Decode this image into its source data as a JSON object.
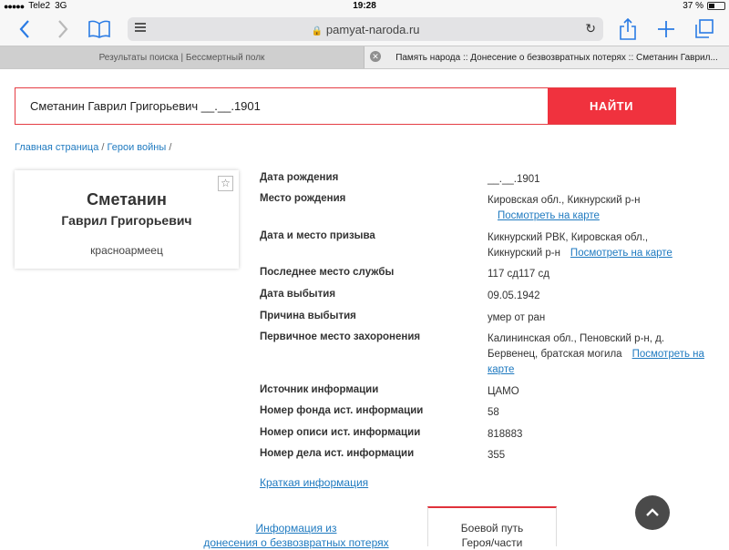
{
  "status_bar": {
    "carrier": "Tele2",
    "network": "3G",
    "time": "19:28",
    "battery": "37 %"
  },
  "browser": {
    "url": "pamyat-naroda.ru",
    "tabs": [
      {
        "label": "Результаты поиска | Бессмертный полк"
      },
      {
        "label": "Память народа :: Донесение о безвозвратных потерях :: Сметанин Гаврил..."
      }
    ]
  },
  "search": {
    "value": "Сметанин Гаврил Григорьевич __.__.1901",
    "button_label": "НАЙТИ"
  },
  "breadcrumb": {
    "home": "Главная страница",
    "heroes": "Герои войны",
    "sep": "/"
  },
  "person": {
    "surname": "Сметанин",
    "given_names": "Гаврил Григорьевич",
    "rank": "красноармеец"
  },
  "details": {
    "birth_date": {
      "label": "Дата рождения",
      "value": "__.__.1901"
    },
    "birth_place": {
      "label": "Место рождения",
      "value": "Кировская обл., Кикнурский р-н"
    },
    "conscription": {
      "label": "Дата и место призыва",
      "value": "Кикнурский РВК, Кировская обл., Кикнурский р-н"
    },
    "last_service": {
      "label": "Последнее место службы",
      "value": "117 сд117 сд"
    },
    "departure_date": {
      "label": "Дата выбытия",
      "value": "09.05.1942"
    },
    "departure_reason": {
      "label": "Причина выбытия",
      "value": "умер от ран"
    },
    "burial": {
      "label": "Первичное место захоронения",
      "value": "Калининская обл., Пеновский р-н, д. Бервенец, братская могила"
    },
    "source": {
      "label": "Источник информации",
      "value": "ЦАМО"
    },
    "fund_no": {
      "label": "Номер фонда ист. информации",
      "value": "58"
    },
    "inventory_no": {
      "label": "Номер описи ист. информации",
      "value": "818883"
    },
    "case_no": {
      "label": "Номер дела ист. информации",
      "value": "355"
    },
    "map_link": "Посмотреть на карте"
  },
  "brief_info": "Краткая информация",
  "bottom_tabs": {
    "info_from_line1": "Информация из",
    "info_from_line2": "донесения о безвозвратных потерях",
    "battle_path": "Боевой путь",
    "battle_path_sub": "Героя/части"
  },
  "colors": {
    "accent_red": "#f0323e",
    "link_blue": "#1f7ac0",
    "ios_blue": "#2a7be4"
  },
  "icons": [
    "back-icon",
    "forward-icon",
    "bookmarks-icon",
    "menu-icon",
    "lock-icon",
    "reload-icon",
    "share-icon",
    "new-tab-icon",
    "tabs-icon",
    "close-tab-icon",
    "star-icon",
    "chevron-up-icon"
  ]
}
